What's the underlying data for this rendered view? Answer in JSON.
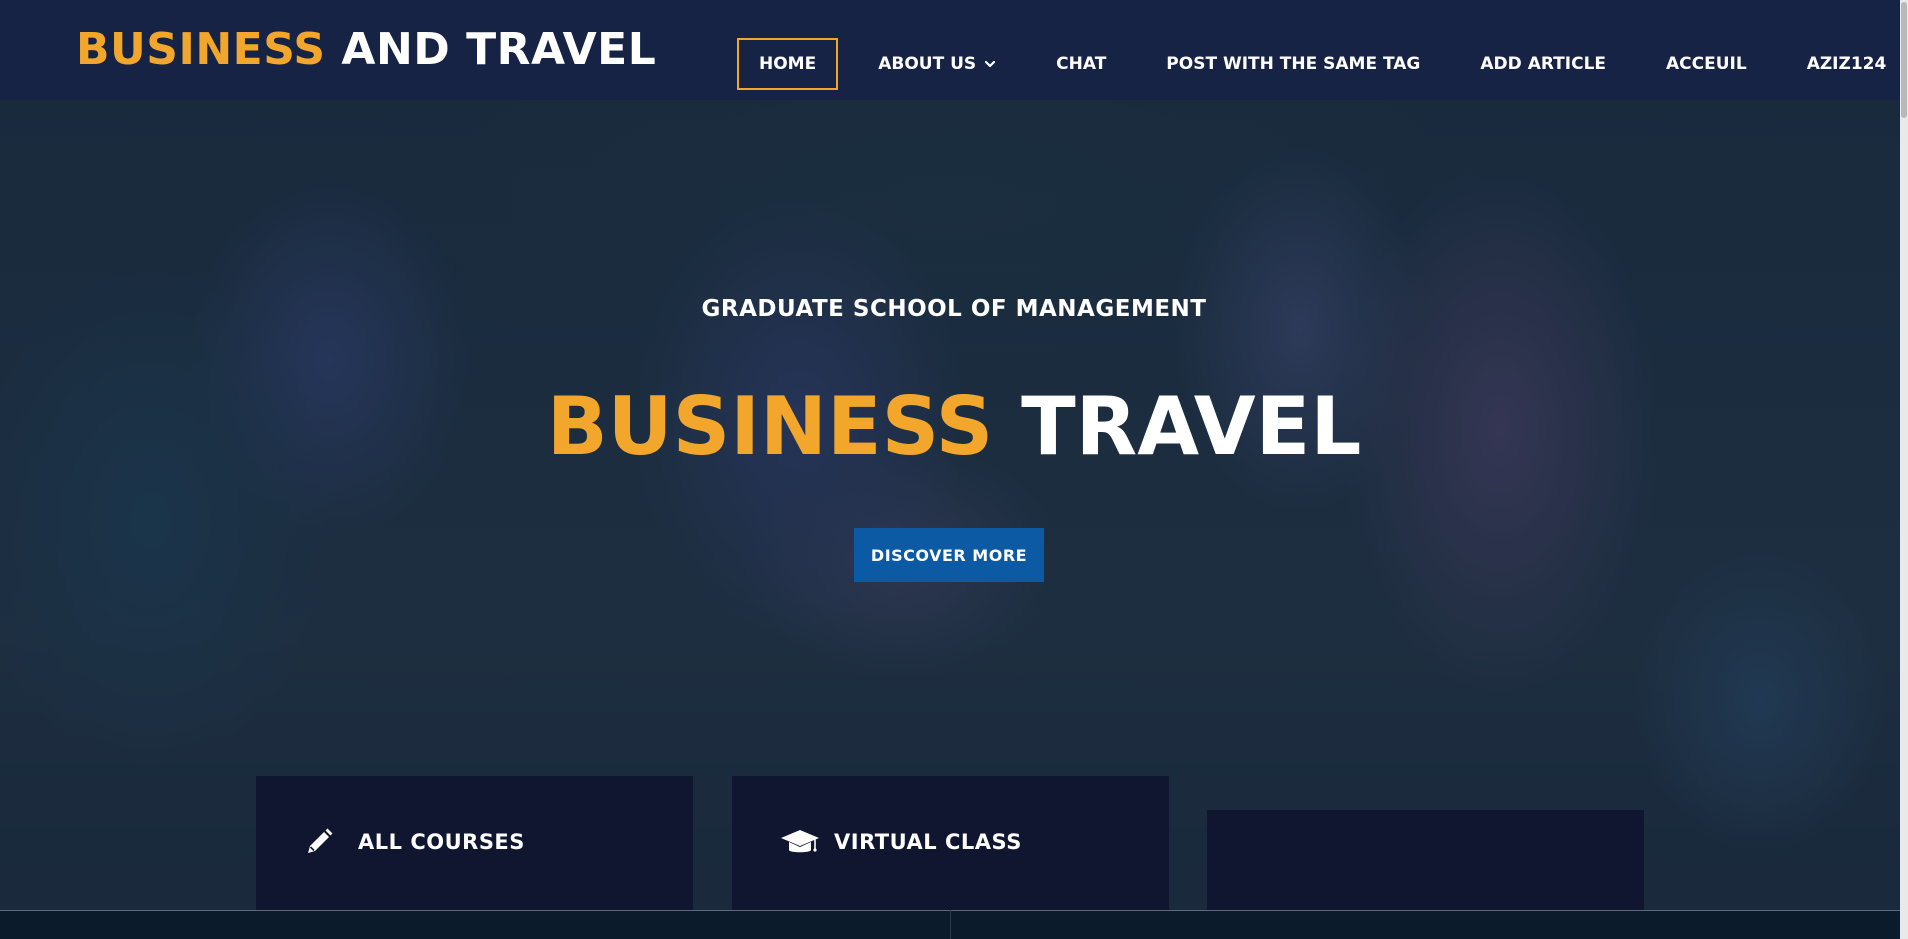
{
  "header": {
    "logo_accent": "BUSINESS",
    "logo_rest": " AND TRAVEL",
    "nav": [
      {
        "label": "HOME",
        "active": true
      },
      {
        "label": "ABOUT US",
        "has_dropdown": true
      },
      {
        "label": "CHAT"
      },
      {
        "label": "POST WITH THE SAME TAG"
      },
      {
        "label": "ADD ARTICLE"
      },
      {
        "label": "ACCEUIL"
      },
      {
        "label": "AZIZ124"
      }
    ]
  },
  "hero": {
    "subtitle": "GRADUATE SCHOOL OF MANAGEMENT",
    "headline_accent": "BUSINESS",
    "headline_rest": " TRAVEL",
    "cta_label": "DISCOVER MORE"
  },
  "cards": [
    {
      "label": "ALL COURSES",
      "icon": "pencil-icon"
    },
    {
      "label": "VIRTUAL CLASS",
      "icon": "graduation-cap-icon"
    },
    {
      "label": "",
      "icon": ""
    }
  ],
  "colors": {
    "accent": "#f2a72c",
    "header_bg": "#172344",
    "cta_bg": "#0c5aa4",
    "card_bg": "#101530"
  }
}
